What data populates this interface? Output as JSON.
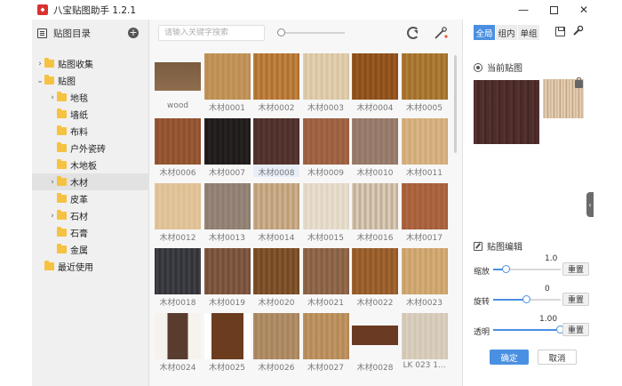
{
  "window": {
    "title": "八宝贴图助手 1.2.1",
    "minimize_label": "—",
    "close_label": "✕"
  },
  "sidebar": {
    "title": "贴图目录",
    "add_label": "+",
    "items": [
      {
        "label": "贴图收集",
        "caret": "›"
      },
      {
        "label": "贴图",
        "caret": "⌄"
      },
      {
        "label": "地毯",
        "caret": "›"
      },
      {
        "label": "墙纸",
        "caret": ""
      },
      {
        "label": "布料",
        "caret": ""
      },
      {
        "label": "户外瓷砖",
        "caret": ""
      },
      {
        "label": "木地板",
        "caret": ""
      },
      {
        "label": "木材",
        "caret": "›"
      },
      {
        "label": "皮革",
        "caret": ""
      },
      {
        "label": "石材",
        "caret": "›"
      },
      {
        "label": "石膏",
        "caret": ""
      },
      {
        "label": "金属",
        "caret": ""
      },
      {
        "label": "最近使用",
        "caret": ""
      }
    ]
  },
  "toolbar": {
    "search_placeholder": "请输入关键字搜索"
  },
  "textures": [
    {
      "label": "wood",
      "colors": [
        "#7a5c40",
        "#8e6d4e"
      ]
    },
    {
      "label": "木材0001",
      "colors": [
        "#c79a5f",
        "#b98a52"
      ]
    },
    {
      "label": "木材0002",
      "colors": [
        "#c98a45",
        "#a86a2e"
      ]
    },
    {
      "label": "木材0003",
      "colors": [
        "#e4d3b4",
        "#d6c19c"
      ]
    },
    {
      "label": "木材0004",
      "colors": [
        "#9e5e24",
        "#84491a"
      ]
    },
    {
      "label": "木材0005",
      "colors": [
        "#b7833c",
        "#9a6a2a"
      ]
    },
    {
      "label": "木材0006",
      "colors": [
        "#9d5e38",
        "#8a4e2c"
      ]
    },
    {
      "label": "木材0007",
      "colors": [
        "#2b2424",
        "#1c1818"
      ]
    },
    {
      "label": "木材0008",
      "colors": [
        "#5a3a34",
        "#4a2c28"
      ]
    },
    {
      "label": "木材0009",
      "colors": [
        "#a76a4a",
        "#955b3e"
      ]
    },
    {
      "label": "木材0010",
      "colors": [
        "#a08473",
        "#8f7263"
      ]
    },
    {
      "label": "木材0011",
      "colors": [
        "#ddb88a",
        "#cda675"
      ]
    },
    {
      "label": "木材0012",
      "colors": [
        "#e6c9a0",
        "#dcbc90"
      ]
    },
    {
      "label": "木材0013",
      "colors": [
        "#9b8a7c",
        "#8b7a6d"
      ]
    },
    {
      "label": "木材0014",
      "colors": [
        "#d2b895",
        "#b89671"
      ]
    },
    {
      "label": "木材0015",
      "colors": [
        "#ebe2d2",
        "#ddd2bf"
      ]
    },
    {
      "label": "木材0016",
      "colors": [
        "#e3d6c2",
        "#b9a78f"
      ]
    },
    {
      "label": "木材0017",
      "colors": [
        "#b46a45",
        "#a05b38"
      ]
    },
    {
      "label": "木材0018",
      "colors": [
        "#2d2d33",
        "#45454c"
      ]
    },
    {
      "label": "木材0019",
      "colors": [
        "#8a6048",
        "#6f4a36"
      ]
    },
    {
      "label": "木材0020",
      "colors": [
        "#8a5c32",
        "#6e4420"
      ]
    },
    {
      "label": "木材0021",
      "colors": [
        "#9b7050",
        "#7f5a40"
      ]
    },
    {
      "label": "木材0022",
      "colors": [
        "#a76a33",
        "#8c5526"
      ]
    },
    {
      "label": "木材0023",
      "colors": [
        "#d7b07a",
        "#c69c66"
      ]
    },
    {
      "label": "木材0024",
      "colors": [
        "#5a3c2e",
        "#f6f3ee"
      ]
    },
    {
      "label": "木材0025",
      "colors": [
        "#6b3c1e",
        "#7b4a28"
      ]
    },
    {
      "label": "木材0026",
      "colors": [
        "#b8946c",
        "#a3805b"
      ]
    },
    {
      "label": "木材0027",
      "colors": [
        "#c49a68",
        "#b08554"
      ]
    },
    {
      "label": "木材0028",
      "colors": [
        "#6a3a22",
        "#f5f5f5"
      ]
    },
    {
      "label": "LK 023 1...",
      "colors": [
        "#ddd2c3",
        "#d0c3b1"
      ]
    }
  ],
  "right_panel": {
    "tabs": [
      {
        "label": "全局",
        "active": true
      },
      {
        "label": "组内",
        "active": false
      },
      {
        "label": "单组",
        "active": false
      }
    ],
    "current_title": "当前贴图",
    "edit_title": "贴图编辑",
    "controls": [
      {
        "label": "缩放",
        "value": "1.0",
        "fraction": 0.2,
        "reset": "重置"
      },
      {
        "label": "旋转",
        "value": "0",
        "fraction": 0.5,
        "reset": "重置"
      },
      {
        "label": "透明",
        "value": "1.00",
        "fraction": 1.0,
        "reset": "重置"
      }
    ],
    "ok_label": "确定",
    "cancel_label": "取消",
    "collapse_label": "‹"
  },
  "colors": {
    "accent": "#4a90e2",
    "folder": "#f5c242"
  }
}
